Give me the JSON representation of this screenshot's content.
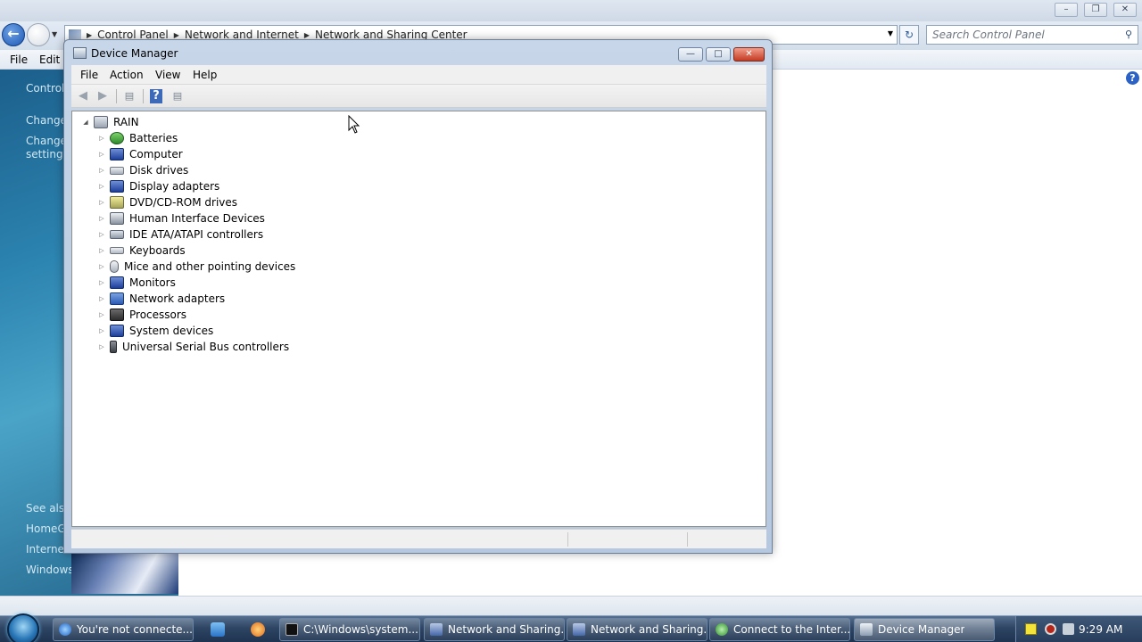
{
  "background_window": {
    "breadcrumbs": [
      "Control Panel",
      "Network and Internet",
      "Network and Sharing Center"
    ],
    "search_placeholder": "Search Control Panel",
    "menu": [
      "File",
      "Edit"
    ],
    "caption_buttons": {
      "minimize": "–",
      "maximize": "❐",
      "close": "✕"
    },
    "left_pane_links": [
      "Control",
      "Change",
      "Change",
      "settings",
      "See also",
      "HomeG",
      "Internet",
      "Windows Firewall"
    ]
  },
  "device_manager": {
    "title": "Device Manager",
    "menu": [
      "File",
      "Action",
      "View",
      "Help"
    ],
    "root": "RAIN",
    "categories": [
      {
        "label": "Batteries",
        "icon": "battery-icon"
      },
      {
        "label": "Computer",
        "icon": "computer-icon"
      },
      {
        "label": "Disk drives",
        "icon": "disk-drive-icon"
      },
      {
        "label": "Display adapters",
        "icon": "display-adapter-icon"
      },
      {
        "label": "DVD/CD-ROM drives",
        "icon": "dvd-drive-icon"
      },
      {
        "label": "Human Interface Devices",
        "icon": "hid-icon"
      },
      {
        "label": "IDE ATA/ATAPI controllers",
        "icon": "ide-controller-icon"
      },
      {
        "label": "Keyboards",
        "icon": "keyboard-icon"
      },
      {
        "label": "Mice and other pointing devices",
        "icon": "mouse-icon"
      },
      {
        "label": "Monitors",
        "icon": "monitor-icon"
      },
      {
        "label": "Network adapters",
        "icon": "network-adapter-icon"
      },
      {
        "label": "Processors",
        "icon": "processor-icon"
      },
      {
        "label": "System devices",
        "icon": "system-devices-icon"
      },
      {
        "label": "Universal Serial Bus controllers",
        "icon": "usb-icon"
      }
    ]
  },
  "taskbar": {
    "items": [
      {
        "label": "You're not connecte...",
        "icon": "ie-icon",
        "active": false
      },
      {
        "label": "C:\\Windows\\system...",
        "icon": "cmd-icon",
        "active": false
      },
      {
        "label": "Network and Sharing...",
        "icon": "network-icon",
        "active": false
      },
      {
        "label": "Network and Sharing...",
        "icon": "network-icon",
        "active": false
      },
      {
        "label": "Connect to the Inter...",
        "icon": "connect-icon",
        "active": false
      },
      {
        "label": "Device Manager",
        "icon": "device-manager-icon",
        "active": true
      }
    ],
    "clock": "9:29 AM"
  },
  "colors": {
    "taskbar": "#2e4563",
    "titlebar": "#c7d6e8",
    "close_button": "#c43b22",
    "left_pane": "#2c84b0"
  }
}
